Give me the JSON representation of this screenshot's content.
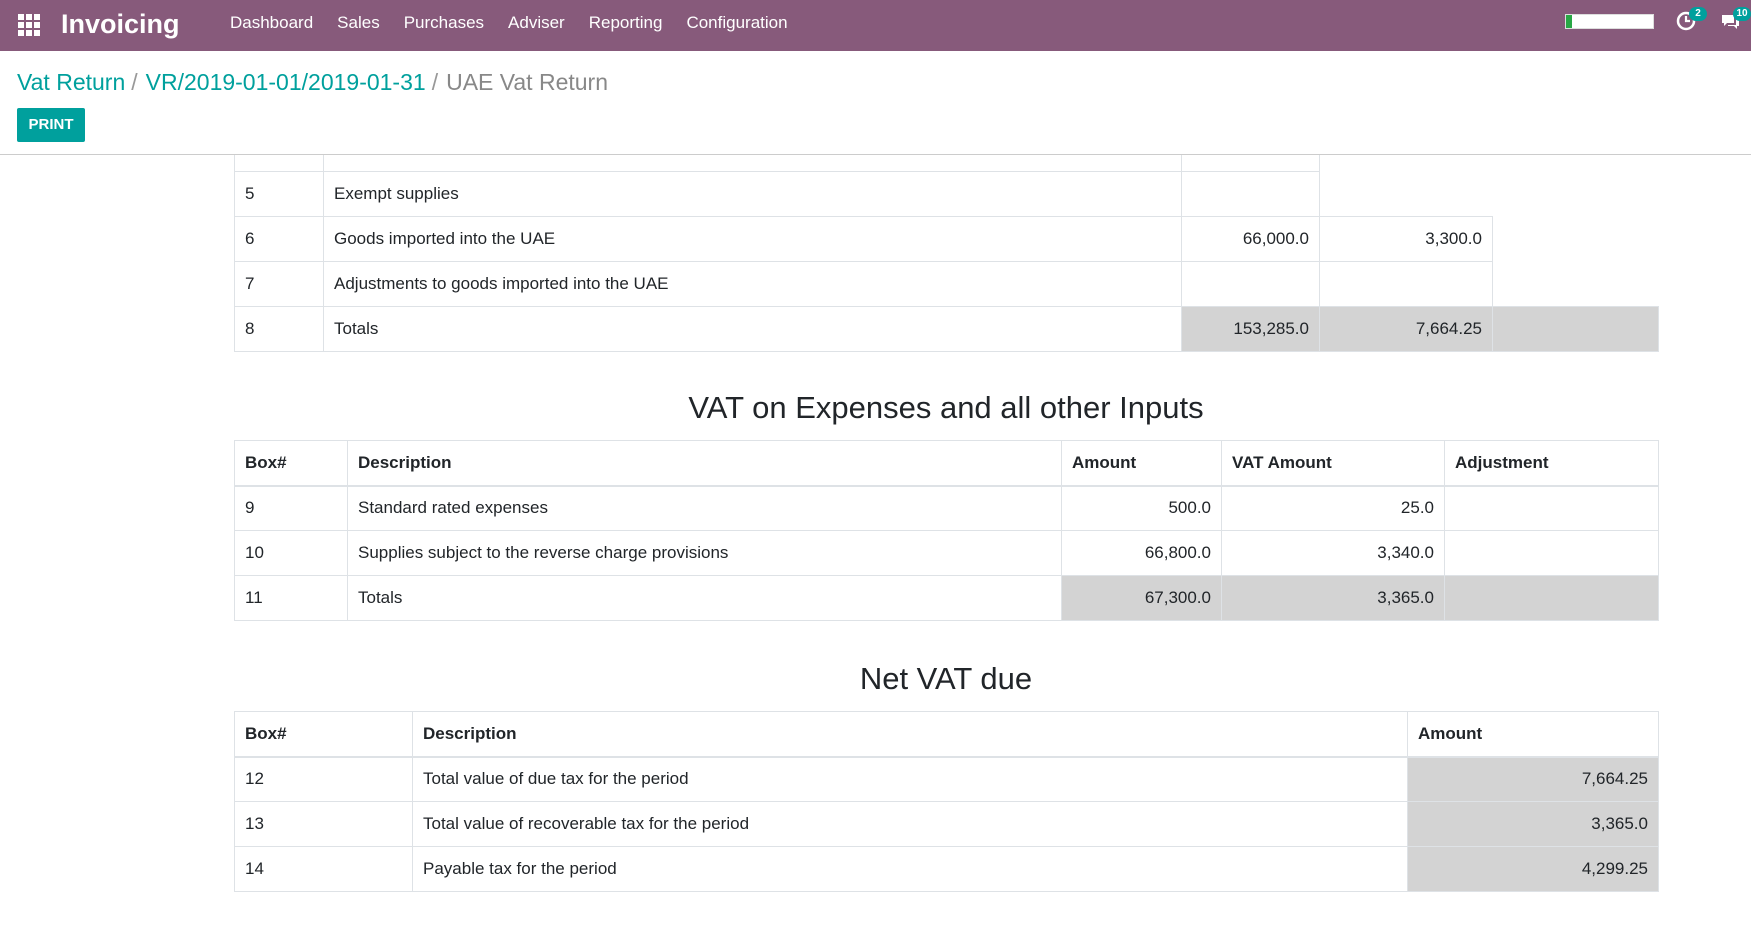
{
  "navbar": {
    "brand": "Invoicing",
    "menu": [
      "Dashboard",
      "Sales",
      "Purchases",
      "Adviser",
      "Reporting",
      "Configuration"
    ],
    "activity_badge": "2",
    "messages_badge": "10",
    "bg_color": "#875a7b"
  },
  "breadcrumb": {
    "items": [
      "Vat Return",
      "VR/2019-01-01/2019-01-31"
    ],
    "separator": "/",
    "current": "UAE Vat Return"
  },
  "control": {
    "print_label": "PRINT",
    "accent_color": "#00a09d"
  },
  "sales_table": {
    "rows": [
      {
        "box": "5",
        "description": "Exempt supplies",
        "amount": "",
        "vat": ""
      },
      {
        "box": "6",
        "description": "Goods imported into the UAE",
        "amount": "66,000.0",
        "vat": "3,300.0"
      },
      {
        "box": "7",
        "description": "Adjustments to goods imported into the UAE",
        "amount": "",
        "vat": ""
      },
      {
        "box": "8",
        "description": "Totals",
        "amount": "153,285.0",
        "vat": "7,664.25"
      }
    ]
  },
  "expenses": {
    "title": "VAT on Expenses and all other Inputs",
    "headers": [
      "Box#",
      "Description",
      "Amount",
      "VAT Amount",
      "Adjustment"
    ],
    "rows": [
      {
        "box": "9",
        "description": "Standard rated expenses",
        "amount": "500.0",
        "vat": "25.0",
        "adjustment": ""
      },
      {
        "box": "10",
        "description": "Supplies subject to the reverse charge provisions",
        "amount": "66,800.0",
        "vat": "3,340.0",
        "adjustment": ""
      },
      {
        "box": "11",
        "description": "Totals",
        "amount": "67,300.0",
        "vat": "3,365.0",
        "adjustment": ""
      }
    ]
  },
  "net_vat": {
    "title": "Net VAT due",
    "headers": [
      "Box#",
      "Description",
      "Amount"
    ],
    "rows": [
      {
        "box": "12",
        "description": "Total value of due tax for the period",
        "amount": "7,664.25"
      },
      {
        "box": "13",
        "description": "Total value of recoverable tax for the period",
        "amount": "3,365.0"
      },
      {
        "box": "14",
        "description": "Payable tax for the period",
        "amount": "4,299.25"
      }
    ]
  }
}
